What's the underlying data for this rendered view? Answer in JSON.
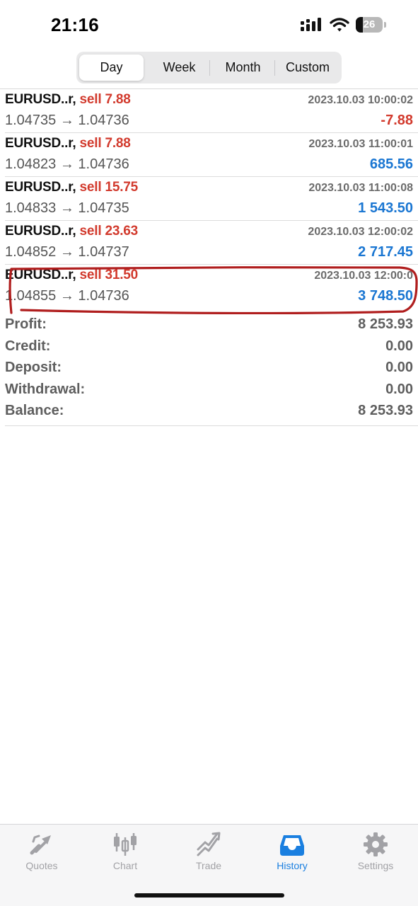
{
  "status_bar": {
    "time": "21:16",
    "battery": "26",
    "battery_percent": 26
  },
  "period_tabs": [
    {
      "label": "Day",
      "active": true
    },
    {
      "label": "Week",
      "active": false
    },
    {
      "label": "Month",
      "active": false
    },
    {
      "label": "Custom",
      "active": false
    }
  ],
  "deals": [
    {
      "symbol": "EURUSD..r,",
      "side": "sell 7.88",
      "datetime": "2023.10.03 10:00:02",
      "prices": "1.04735 → 1.04736",
      "profit": "-7.88",
      "profit_color": "#d23a2d"
    },
    {
      "symbol": "EURUSD..r,",
      "side": "sell 7.88",
      "datetime": "2023.10.03 11:00:01",
      "prices": "1.04823 → 1.04736",
      "profit": "685.56",
      "profit_color": "#1a76d2"
    },
    {
      "symbol": "EURUSD..r,",
      "side": "sell 15.75",
      "datetime": "2023.10.03 11:00:08",
      "prices": "1.04833 → 1.04735",
      "profit": "1 543.50",
      "profit_color": "#1a76d2"
    },
    {
      "symbol": "EURUSD..r,",
      "side": "sell 23.63",
      "datetime": "2023.10.03 12:00:02",
      "prices": "1.04852 → 1.04737",
      "profit": "2 717.45",
      "profit_color": "#1a76d2"
    },
    {
      "symbol": "EURUSD..r,",
      "side": "sell 31.50",
      "datetime": "2023.10.03 12:00:0",
      "prices": "1.04855 → 1.04736",
      "profit": "3 748.50",
      "profit_color": "#1a76d2"
    }
  ],
  "summary": [
    {
      "label": "Profit:",
      "value": "8 253.93"
    },
    {
      "label": "Credit:",
      "value": "0.00"
    },
    {
      "label": "Deposit:",
      "value": "0.00"
    },
    {
      "label": "Withdrawal:",
      "value": "0.00"
    },
    {
      "label": "Balance:",
      "value": "8 253.93"
    }
  ],
  "tabbar": [
    {
      "label": "Quotes",
      "icon": "quotes-icon",
      "active": false
    },
    {
      "label": "Chart",
      "icon": "chart-icon",
      "active": false
    },
    {
      "label": "Trade",
      "icon": "trade-icon",
      "active": false
    },
    {
      "label": "History",
      "icon": "history-icon",
      "active": true
    },
    {
      "label": "Settings",
      "icon": "settings-icon",
      "active": false
    }
  ],
  "colors": {
    "sell": "#d23a2d",
    "profit_positive": "#1a76d2",
    "profit_negative": "#d23a2d",
    "tab_active": "#1a7fe0",
    "tab_inactive": "#a2a2a6",
    "annotation": "#b01e1e"
  }
}
